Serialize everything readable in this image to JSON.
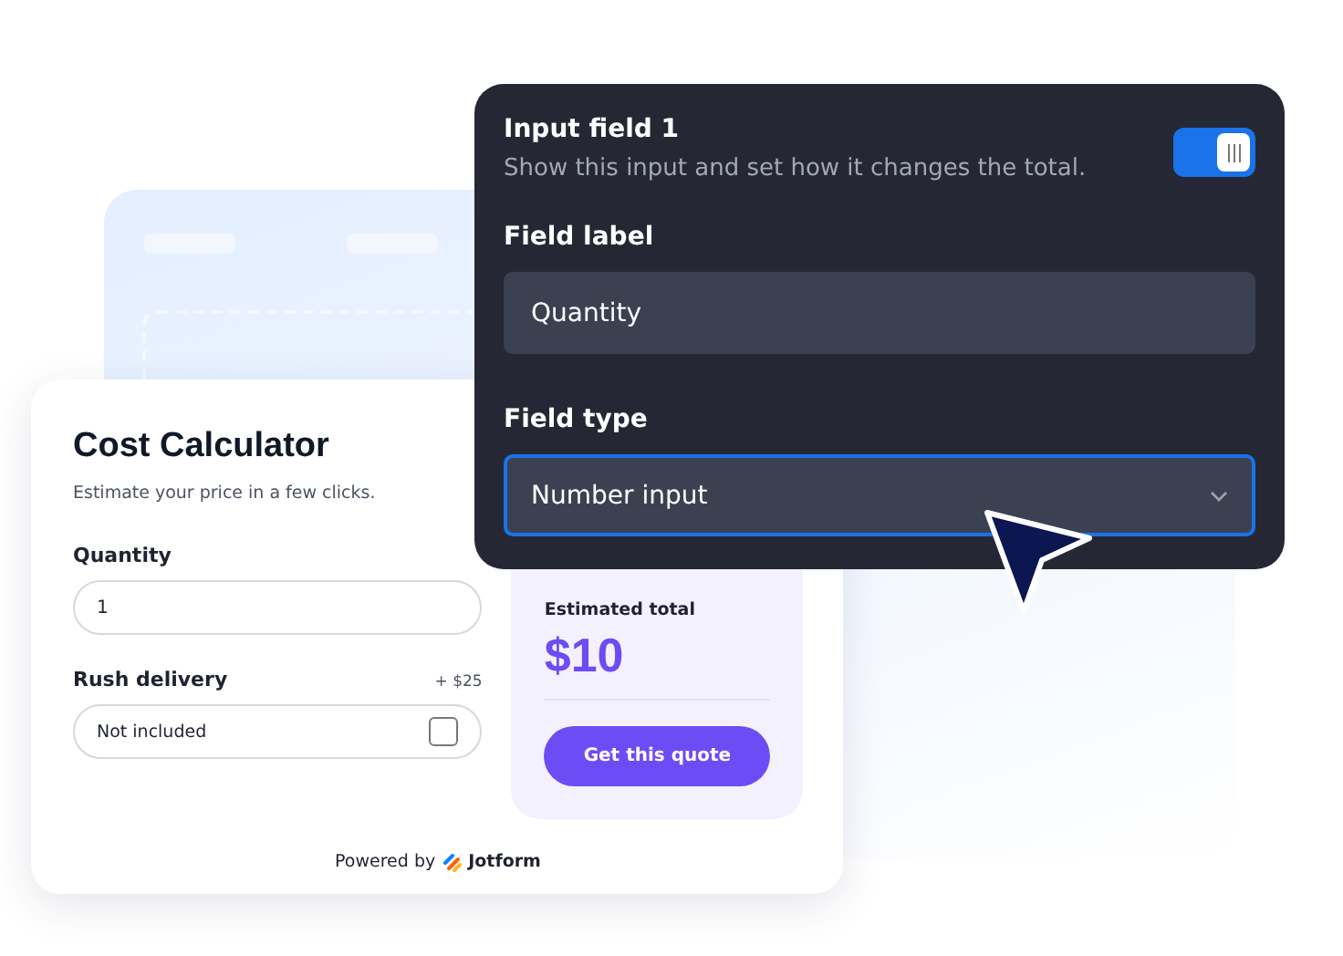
{
  "calculator": {
    "title": "Cost Calculator",
    "subtitle": "Estimate your price in a few clicks.",
    "fields": [
      {
        "kind": "number",
        "label": "Quantity",
        "value": "1"
      },
      {
        "kind": "checkbox",
        "label": "Rush delivery",
        "price": "+ $25",
        "value": "Not included",
        "checked": false
      }
    ],
    "summary": {
      "label": "Estimated total",
      "amount": "$10",
      "button": "Get this quote"
    },
    "footer": {
      "prefix": "Powered by",
      "brand": "Jotform"
    }
  },
  "settings_panel": {
    "title": "Input field 1",
    "description": "Show this input and set how it changes the total.",
    "enabled": true,
    "fields": [
      {
        "kind": "text",
        "label": "Field label",
        "value": "Quantity",
        "focused": false
      },
      {
        "kind": "select",
        "label": "Field type",
        "value": "Number input",
        "focused": true
      }
    ]
  }
}
